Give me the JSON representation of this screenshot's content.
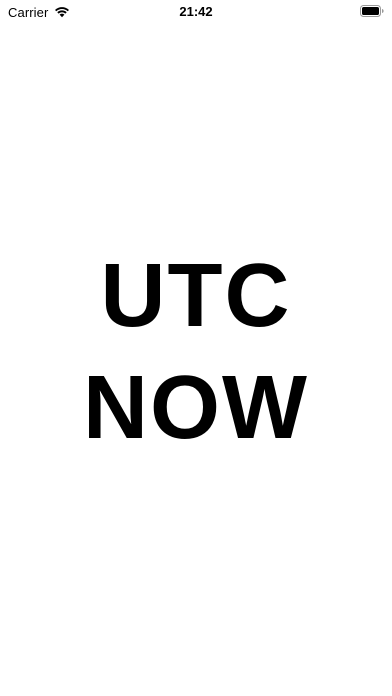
{
  "status_bar": {
    "carrier": "Carrier",
    "time": "21:42",
    "icons": [
      "wifi-icon",
      "battery-icon"
    ]
  },
  "main": {
    "headline_line1": "UTC",
    "headline_line2": "NOW"
  },
  "colors": {
    "background": "#ffffff",
    "text": "#000000"
  }
}
